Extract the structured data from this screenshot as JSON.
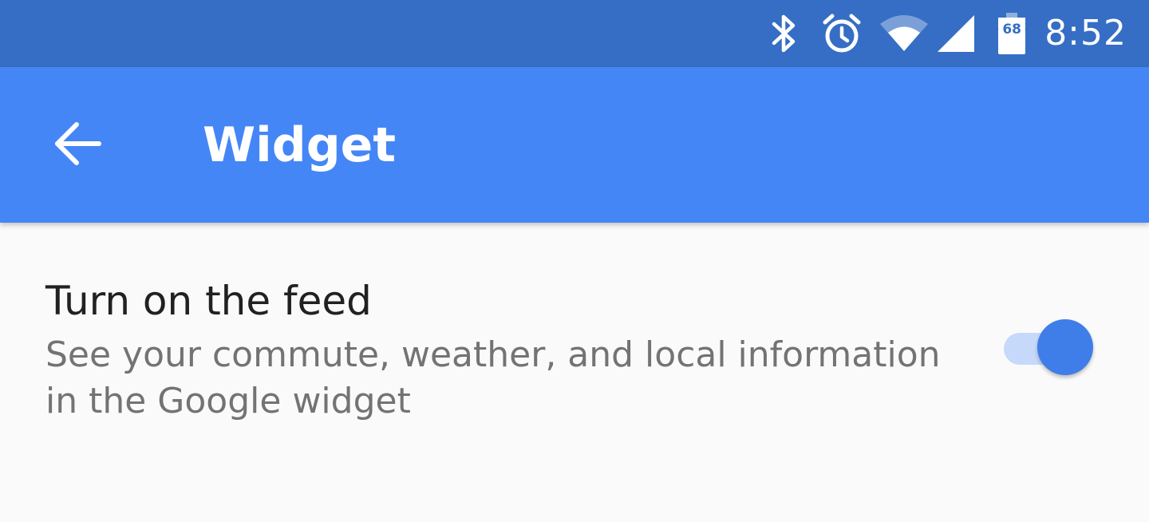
{
  "status_bar": {
    "time": "8:52",
    "battery_level": "68",
    "icons": [
      "bluetooth-icon",
      "alarm-icon",
      "wifi-icon",
      "cell-signal-icon",
      "battery-icon"
    ]
  },
  "app_bar": {
    "title": "Widget",
    "back_icon": "arrow-back-icon"
  },
  "settings": {
    "feed": {
      "title": "Turn on the feed",
      "summary": "See your commute, weather, and local information in the Google widget",
      "enabled": true
    }
  },
  "colors": {
    "status_bar": "#356ec4",
    "app_bar": "#4586f6",
    "background": "#fafafa",
    "toggle_thumb": "#3f7ee8",
    "toggle_track": "#c6d9fb",
    "title_text": "#212121",
    "summary_text": "#737373"
  }
}
